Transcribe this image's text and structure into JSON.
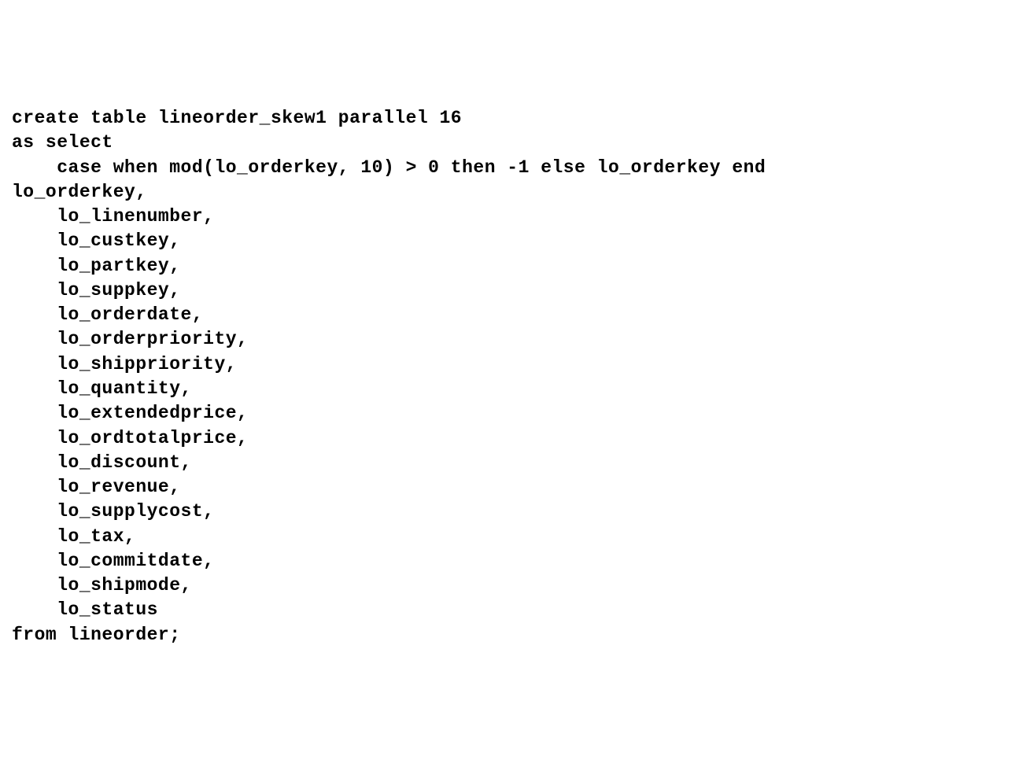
{
  "code": {
    "line1": "create table lineorder_skew1 parallel 16",
    "line2": "as select",
    "line3": "    case when mod(lo_orderkey, 10) > 0 then -1 else lo_orderkey end",
    "line4": "lo_orderkey,",
    "line5": "    lo_linenumber,",
    "line6": "    lo_custkey,",
    "line7": "    lo_partkey,",
    "line8": "    lo_suppkey,",
    "line9": "    lo_orderdate,",
    "line10": "    lo_orderpriority,",
    "line11": "    lo_shippriority,",
    "line12": "    lo_quantity,",
    "line13": "    lo_extendedprice,",
    "line14": "    lo_ordtotalprice,",
    "line15": "    lo_discount,",
    "line16": "    lo_revenue,",
    "line17": "    lo_supplycost,",
    "line18": "    lo_tax,",
    "line19": "    lo_commitdate,",
    "line20": "    lo_shipmode,",
    "line21": "    lo_status",
    "line22": "from lineorder;"
  }
}
